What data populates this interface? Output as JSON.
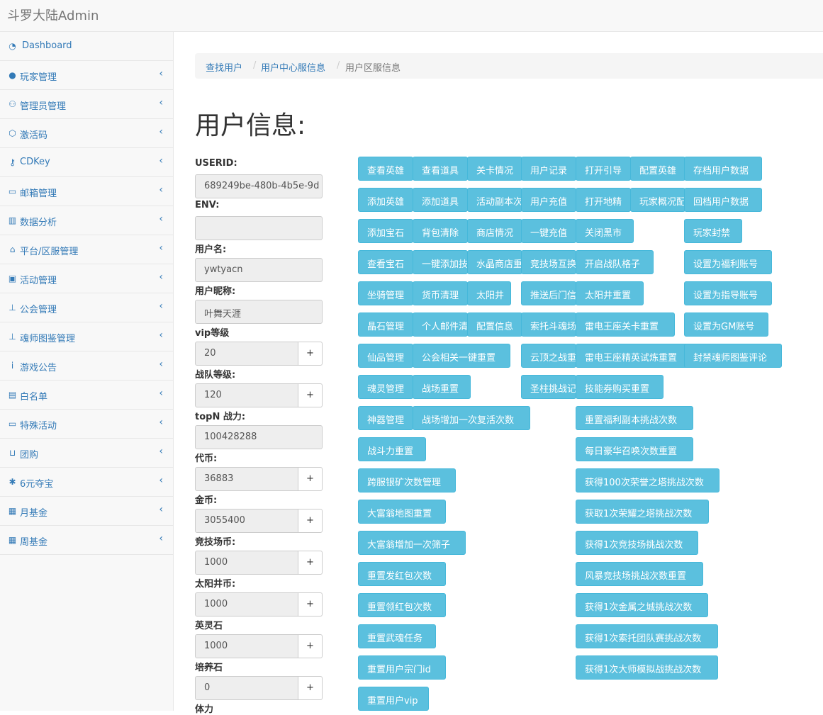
{
  "app": {
    "title": "斗罗大陆Admin"
  },
  "sidebar": {
    "items": [
      {
        "label": "Dashboard",
        "icon": "dashboard-icon"
      },
      {
        "label": "玩家管理",
        "icon": "user-icon"
      },
      {
        "label": "管理员管理",
        "icon": "users-icon"
      },
      {
        "label": "激活码",
        "icon": "codepen-icon"
      },
      {
        "label": "CDKey",
        "icon": "key-icon"
      },
      {
        "label": "邮箱管理",
        "icon": "inbox-icon"
      },
      {
        "label": "数据分析",
        "icon": "bar-chart-icon"
      },
      {
        "label": "平台/区服管理",
        "icon": "bank-icon"
      },
      {
        "label": "活动管理",
        "icon": "gift-icon"
      },
      {
        "label": "公会管理",
        "icon": "sitemap-icon"
      },
      {
        "label": "魂师图鉴管理",
        "icon": "sitemap-icon"
      },
      {
        "label": "游戏公告",
        "icon": "info-icon"
      },
      {
        "label": "白名单",
        "icon": "file-icon"
      },
      {
        "label": "特殊活动",
        "icon": "money-icon"
      },
      {
        "label": "团购",
        "icon": "cart-icon"
      },
      {
        "label": "6元夺宝",
        "icon": "asterisk-icon"
      },
      {
        "label": "月基金",
        "icon": "calendar-icon"
      },
      {
        "label": "周基金",
        "icon": "calendar-icon"
      }
    ]
  },
  "breadcrumb": {
    "items": [
      "查找用户",
      "用户中心服信息",
      "用户区服信息"
    ]
  },
  "page": {
    "title": "用户信息:"
  },
  "fields": [
    {
      "label": "USERID:",
      "value": "689249be-480b-4b5e-9d",
      "plus": false
    },
    {
      "label": "ENV:",
      "value": "",
      "plus": false
    },
    {
      "label": "用户名:",
      "value": "ywtyacn",
      "plus": false
    },
    {
      "label": "用户昵称:",
      "value": "叶舞天涯",
      "plus": false
    },
    {
      "label": "vip等级",
      "value": "20",
      "plus": true
    },
    {
      "label": "战队等级:",
      "value": "120",
      "plus": true
    },
    {
      "label": "topN 战力:",
      "value": "100428288",
      "plus": false
    },
    {
      "label": "代币:",
      "value": "36883",
      "plus": true
    },
    {
      "label": "金币:",
      "value": "3055400",
      "plus": true
    },
    {
      "label": "竞技场币:",
      "value": "1000",
      "plus": true
    },
    {
      "label": "太阳井币:",
      "value": "1000",
      "plus": true
    },
    {
      "label": "英灵石",
      "value": "1000",
      "plus": true
    },
    {
      "label": "培养石",
      "value": "0",
      "plus": true
    },
    {
      "label": "体力",
      "value": "",
      "plus": false
    }
  ],
  "plus_label": "+",
  "buttons": [
    {
      "label": "查看英雄"
    },
    {
      "label": "查看道具"
    },
    {
      "label": "关卡情况"
    },
    {
      "label": "用户记录"
    },
    {
      "label": "打开引导"
    },
    {
      "label": "配置英雄"
    },
    {
      "label": "存档用户数据"
    },
    {
      "label": "添加英雄"
    },
    {
      "label": "添加道具"
    },
    {
      "label": "活动副本次数"
    },
    {
      "label": "用户充值"
    },
    {
      "label": "打开地精"
    },
    {
      "label": "玩家概况配置"
    },
    {
      "label": "回档用户数据"
    },
    {
      "label": "添加宝石"
    },
    {
      "label": "背包清除"
    },
    {
      "label": "商店情况"
    },
    {
      "label": "一键充值"
    },
    {
      "label": "关闭黑市"
    },
    {
      "label": "玩家封禁"
    },
    {
      "label": "查看宝石"
    },
    {
      "label": "一键添加技能"
    },
    {
      "label": "水晶商店重置"
    },
    {
      "label": "竞技场互换排名"
    },
    {
      "label": "开启战队格子"
    },
    {
      "label": "设置为福利账号"
    },
    {
      "label": "坐骑管理"
    },
    {
      "label": "货币清理"
    },
    {
      "label": "太阳井"
    },
    {
      "label": "推送后门信息"
    },
    {
      "label": "太阳井重置"
    },
    {
      "label": "设置为指导账号"
    },
    {
      "label": "晶石管理"
    },
    {
      "label": "个人邮件清除"
    },
    {
      "label": "配置信息"
    },
    {
      "label": "索托斗魂场重置"
    },
    {
      "label": "雷电王座关卡重置"
    },
    {
      "label": "设置为GM账号"
    },
    {
      "label": "仙品管理"
    },
    {
      "label": "公会相关一键重置"
    },
    {
      "label": "云顶之战重置"
    },
    {
      "label": "雷电王座精英试炼重置"
    },
    {
      "label": "封禁魂师图鉴评论"
    },
    {
      "label": "魂灵管理"
    },
    {
      "label": "战场重置"
    },
    {
      "label": "圣柱挑战记录"
    },
    {
      "label": "技能券购买重置"
    },
    {
      "label": "神器管理"
    },
    {
      "label": "战场增加一次复活次数"
    },
    {
      "label": "重置福利副本挑战次数"
    },
    {
      "label": "战斗力重置"
    },
    {
      "label": "每日豪华召唤次数重置"
    },
    {
      "label": "跨服银矿次数管理"
    },
    {
      "label": "获得100次荣誉之塔挑战次数"
    },
    {
      "label": "大富翁地图重置"
    },
    {
      "label": "获取1次荣耀之塔挑战次数"
    },
    {
      "label": "大富翁增加一次筛子"
    },
    {
      "label": "获得1次竞技场挑战次数"
    },
    {
      "label": "重置发红包次数"
    },
    {
      "label": "风暴竞技场挑战次数重置"
    },
    {
      "label": "重置领红包次数"
    },
    {
      "label": "获得1次金属之城挑战次数"
    },
    {
      "label": "重置武魂任务"
    },
    {
      "label": "获得1次索托团队赛挑战次数"
    },
    {
      "label": "重置用户宗门id"
    },
    {
      "label": "获得1次大师模拟战挑战次数"
    },
    {
      "label": "重置用户vip"
    }
  ]
}
